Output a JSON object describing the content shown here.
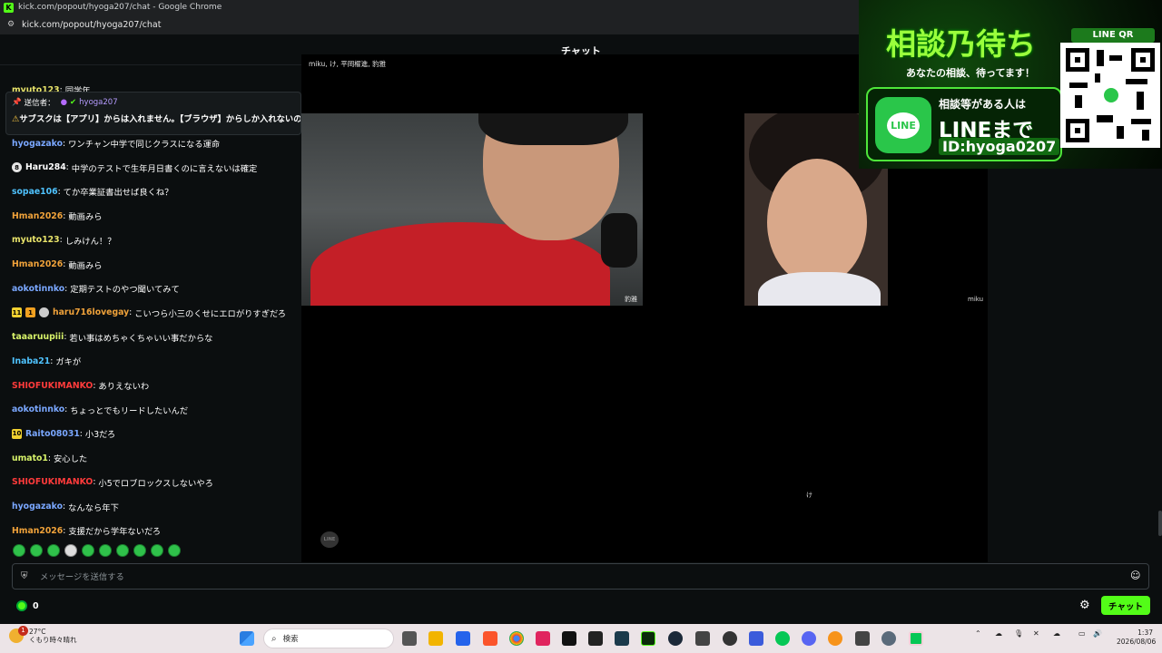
{
  "window": {
    "title": "kick.com/popout/hyoga207/chat - Google Chrome",
    "url": "kick.com/popout/hyoga207/chat"
  },
  "chat": {
    "title": "チャット",
    "partial_top": {
      "user": "myuto123",
      "text": "同学年"
    },
    "pinned": {
      "label": "送信者：",
      "user": "hyoga207",
      "text": "サブスクは【アプリ】からは入れません。【ブラウザ】からしか入れないので"
    },
    "messages": [
      {
        "user": "hyogazako",
        "color": "#7aa7ff",
        "text": "ワンチャン中学で同じクラスになる運命"
      },
      {
        "user": "Haru284",
        "color": "#ffffff",
        "text": "中学のテストで生年月日書くのに言えないは確定",
        "badges": [
          "8"
        ]
      },
      {
        "user": "sopae106",
        "color": "#4fc3ff",
        "text": "てか卒業証書出せば良くね？"
      },
      {
        "user": "Hman2026",
        "color": "#f0a23a",
        "text": "動画みら"
      },
      {
        "user": "myuto123",
        "color": "#e8e36a",
        "text": "しみけん！？"
      },
      {
        "user": "Hman2026",
        "color": "#f0a23a",
        "text": "動画みら"
      },
      {
        "user": "aokotinnko",
        "color": "#7aa7ff",
        "text": "定期テストのやつ聞いてみて"
      },
      {
        "user": "haru716lovegay",
        "color": "#f0a23a",
        "text": "こいつら小三のくせにエロがりすぎだろ",
        "badges": [
          "11",
          "1",
          "s"
        ]
      },
      {
        "user": "taaaruupiii",
        "color": "#d8f36a",
        "text": "若い事はめちゃくちゃいい事だからな"
      },
      {
        "user": "Inaba21",
        "color": "#4fc3ff",
        "text": "ガキが"
      },
      {
        "user": "SHIOFUKIMANKO",
        "color": "#ff3b3b",
        "text": "ありえないわ"
      },
      {
        "user": "aokotinnko",
        "color": "#7aa7ff",
        "text": "ちょっとでもリードしたいんだ"
      },
      {
        "user": "Raito08031",
        "color": "#7aa7ff",
        "text": "小3だろ",
        "badges": [
          "10"
        ]
      },
      {
        "user": "umato1",
        "color": "#d8f36a",
        "text": "安心した"
      },
      {
        "user": "SHIOFUKIMANKO",
        "color": "#ff3b3b",
        "text": "小5でロブロックスしないやろ"
      },
      {
        "user": "hyogazako",
        "color": "#7aa7ff",
        "text": "なんなら年下"
      },
      {
        "user": "Hman2026",
        "color": "#f0a23a",
        "text": "支援だから学年ないだろ"
      }
    ],
    "input_placeholder": "メッセージを送信する",
    "points": "0",
    "send_label": "チャット"
  },
  "overlay": {
    "participants": "miku, け, 平岡櫂進, 豹雅",
    "label_left": "豹雅",
    "label_right": "miku",
    "label_bottom": "け",
    "line_logo": "LINE"
  },
  "ad": {
    "headline": "相談乃待ち",
    "subline": "あなたの相談、待ってます！",
    "line_icon": "LINE",
    "card_line1": "相談等がある人は",
    "card_line2": "LINEまで",
    "card_line3": "ID:hyoga0207",
    "qr_label": "LINE QR"
  },
  "taskbar": {
    "weather_temp": "27°C",
    "weather_desc": "くもり時々晴れ",
    "notif_count": "1",
    "search_placeholder": "検索",
    "time": "1:37",
    "date": "2026/08/06"
  }
}
